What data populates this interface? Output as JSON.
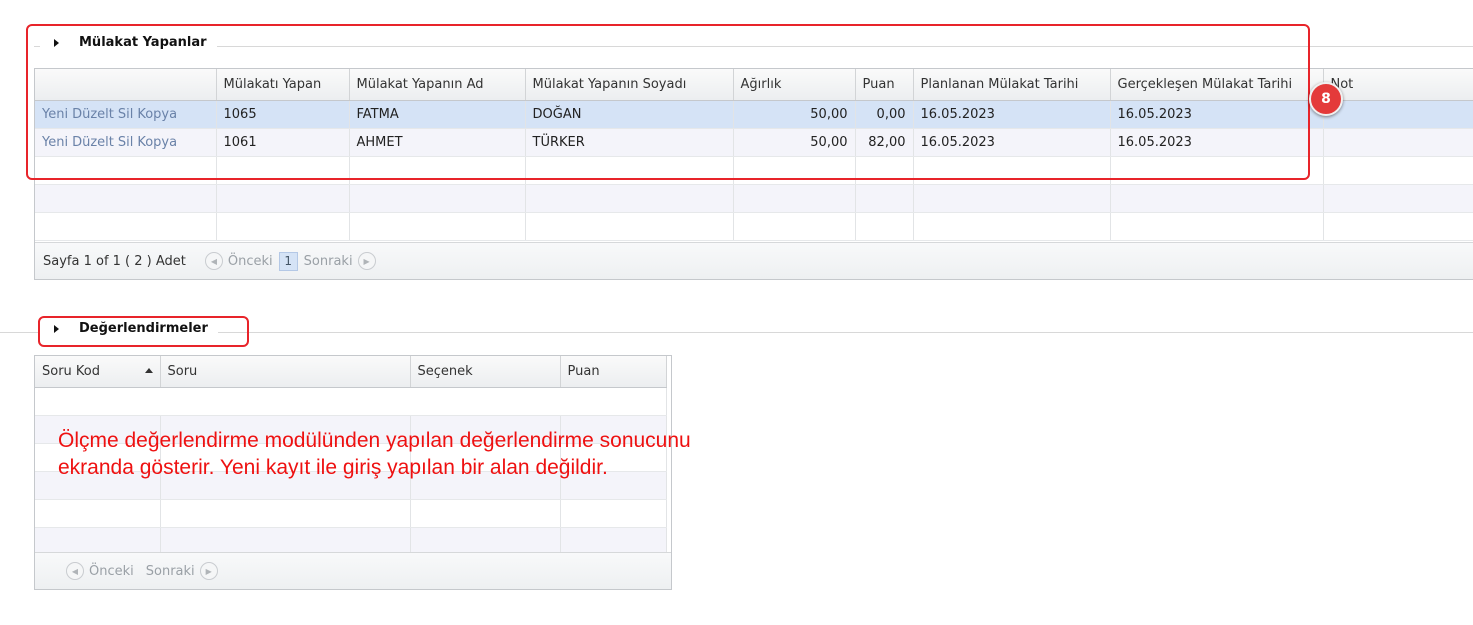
{
  "section1": {
    "legend": "Mülakat Yapanlar",
    "columns": [
      "",
      "Mülakatı Yapan",
      "Mülakat Yapanın Ad",
      "Mülakat Yapanın Soyadı",
      "Ağırlık",
      "Puan",
      "Planlanan Mülakat Tarihi",
      "Gerçekleşen Mülakat Tarihi",
      "Not"
    ],
    "row_actions": [
      "Yeni",
      "Düzelt",
      "Sil",
      "Kopya"
    ],
    "rows": [
      {
        "id": "1065",
        "ad": "FATMA",
        "soyad": "DOĞAN",
        "agirlik": "50,00",
        "puan": "0,00",
        "planlanan": "16.05.2023",
        "gerceklesen": "16.05.2023",
        "not": ""
      },
      {
        "id": "1061",
        "ad": "AHMET",
        "soyad": "TÜRKER",
        "agirlik": "50,00",
        "puan": "82,00",
        "planlanan": "16.05.2023",
        "gerceklesen": "16.05.2023",
        "not": ""
      }
    ],
    "pager": {
      "info": "Sayfa 1 of 1 ( 2 ) Adet",
      "prev": "Önceki",
      "page": "1",
      "next": "Sonraki"
    }
  },
  "section2": {
    "legend": "Değerlendirmeler",
    "columns": [
      "Soru Kod",
      "Soru",
      "Seçenek",
      "Puan"
    ],
    "pager": {
      "prev": "Önceki",
      "next": "Sonraki"
    }
  },
  "annotation": {
    "badge": "8",
    "note": "Ölçme değerlendirme modülünden yapılan değerlendirme sonucunu ekranda gösterir. Yeni kayıt ile giriş yapılan bir alan değildir.",
    "color": "#e8242a"
  },
  "icons": {
    "expand": "triangle-right-icon",
    "prev": "arrow-left-circle-icon",
    "next": "arrow-right-circle-icon",
    "sort": "sort-asc-icon"
  }
}
